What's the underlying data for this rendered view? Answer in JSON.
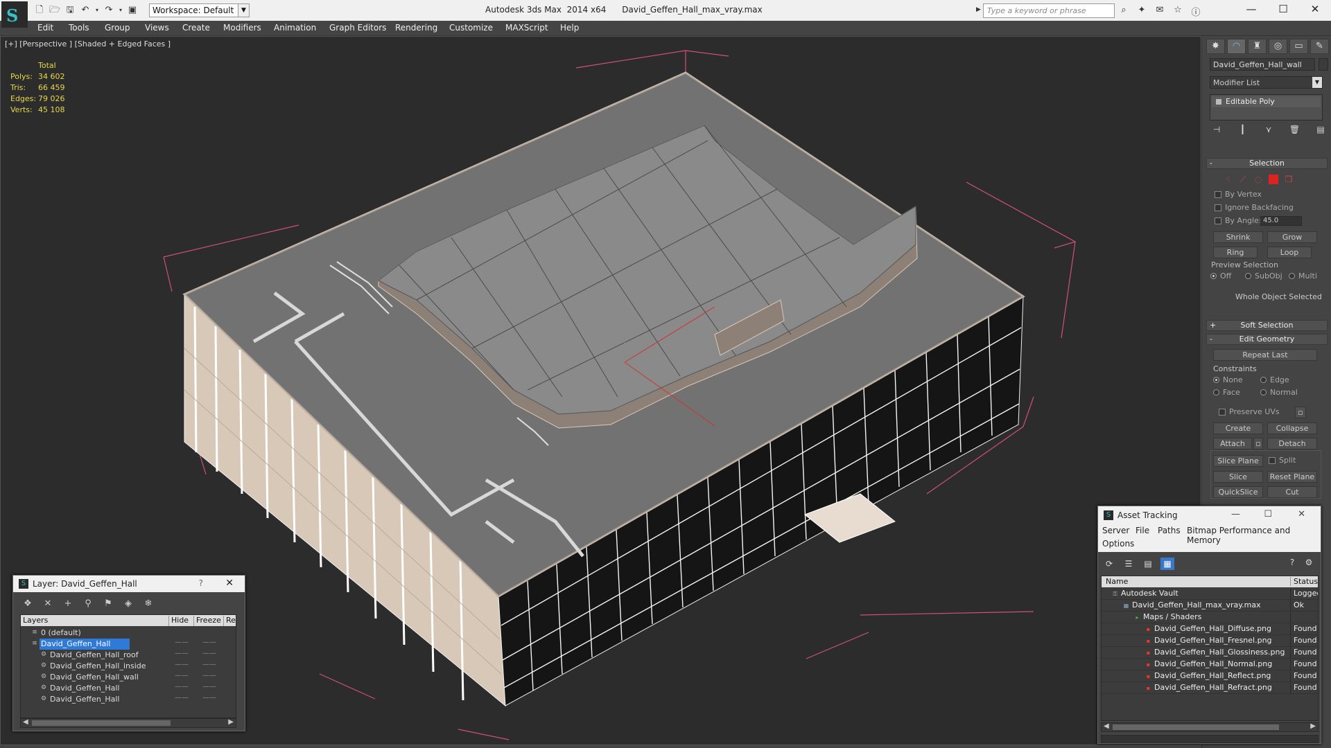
{
  "title_bar": {
    "workspace": "Workspace: Default",
    "app_name": "Autodesk 3ds Max  2014 x64",
    "file_name": "David_Geffen_Hall_max_vray.max",
    "search_placeholder": "Type a keyword or phrase"
  },
  "menu": [
    "Edit",
    "Tools",
    "Group",
    "Views",
    "Create",
    "Modifiers",
    "Animation",
    "Graph Editors",
    "Rendering",
    "Customize",
    "MAXScript",
    "Help"
  ],
  "viewport": {
    "label": "[+] [Perspective ] [Shaded + Edged Faces ]",
    "stats_header": "Total",
    "stats": [
      {
        "label": "Polys:",
        "value": "34 602"
      },
      {
        "label": "Tris:",
        "value": "66 459"
      },
      {
        "label": "Edges:",
        "value": "79 026"
      },
      {
        "label": "Verts:",
        "value": "45 108"
      }
    ]
  },
  "command_panel": {
    "object_name": "David_Geffen_Hall_wall",
    "modifier_list": "Modifier List",
    "stack_item": "Editable Poly",
    "selection": {
      "header": "Selection",
      "by_vertex": "By Vertex",
      "ignore_backfacing": "Ignore Backfacing",
      "by_angle": "By Angle:",
      "angle_value": "45.0",
      "shrink": "Shrink",
      "grow": "Grow",
      "ring": "Ring",
      "loop": "Loop",
      "preview_selection": "Preview Selection",
      "off": "Off",
      "subobj": "SubObj",
      "multi": "Multi",
      "status": "Whole Object Selected"
    },
    "soft_selection": "Soft Selection",
    "edit_geometry": {
      "header": "Edit Geometry",
      "repeat_last": "Repeat Last",
      "constraints": "Constraints",
      "none": "None",
      "edge": "Edge",
      "face": "Face",
      "normal": "Normal",
      "preserve_uvs": "Preserve UVs",
      "create": "Create",
      "collapse": "Collapse",
      "attach": "Attach",
      "detach": "Detach",
      "slice_plane": "Slice Plane",
      "split": "Split",
      "slice": "Slice",
      "reset_plane": "Reset Plane",
      "quickslice": "QuickSlice",
      "cut": "Cut"
    }
  },
  "layer_dialog": {
    "title": "Layer: David_Geffen_Hall",
    "help": "?",
    "columns": [
      "Layers",
      "Hide",
      "Freeze",
      "Ren"
    ],
    "rows": [
      {
        "name": "0 (default)",
        "indent": 0
      },
      {
        "name": "David_Geffen_Hall",
        "indent": 0,
        "selected": true
      },
      {
        "name": "David_Geffen_Hall_roof",
        "indent": 1
      },
      {
        "name": "David_Geffen_Hall_inside",
        "indent": 1
      },
      {
        "name": "David_Geffen_Hall_wall",
        "indent": 1
      },
      {
        "name": "David_Geffen_Hall",
        "indent": 1
      },
      {
        "name": "David_Geffen_Hall",
        "indent": 1
      }
    ]
  },
  "asset_tracking": {
    "title": "Asset Tracking",
    "menu": [
      "Server",
      "File",
      "Paths",
      "Bitmap Performance and Memory",
      "Options"
    ],
    "columns": [
      "Name",
      "Status"
    ],
    "rows": [
      {
        "name": "Autodesk Vault",
        "status": "Logged",
        "indent": 1,
        "icon": "vault"
      },
      {
        "name": "David_Geffen_Hall_max_vray.max",
        "status": "Ok",
        "indent": 2,
        "icon": "max"
      },
      {
        "name": "Maps / Shaders",
        "status": "",
        "indent": 3,
        "icon": "folder"
      },
      {
        "name": "David_Geffen_Hall_Diffuse.png",
        "status": "Found",
        "indent": 4,
        "icon": "png"
      },
      {
        "name": "David_Geffen_Hall_Fresnel.png",
        "status": "Found",
        "indent": 4,
        "icon": "png"
      },
      {
        "name": "David_Geffen_Hall_Glossiness.png",
        "status": "Found",
        "indent": 4,
        "icon": "png"
      },
      {
        "name": "David_Geffen_Hall_Normal.png",
        "status": "Found",
        "indent": 4,
        "icon": "png"
      },
      {
        "name": "David_Geffen_Hall_Reflect.png",
        "status": "Found",
        "indent": 4,
        "icon": "png"
      },
      {
        "name": "David_Geffen_Hall_Refract.png",
        "status": "Found",
        "indent": 4,
        "icon": "png"
      }
    ]
  }
}
